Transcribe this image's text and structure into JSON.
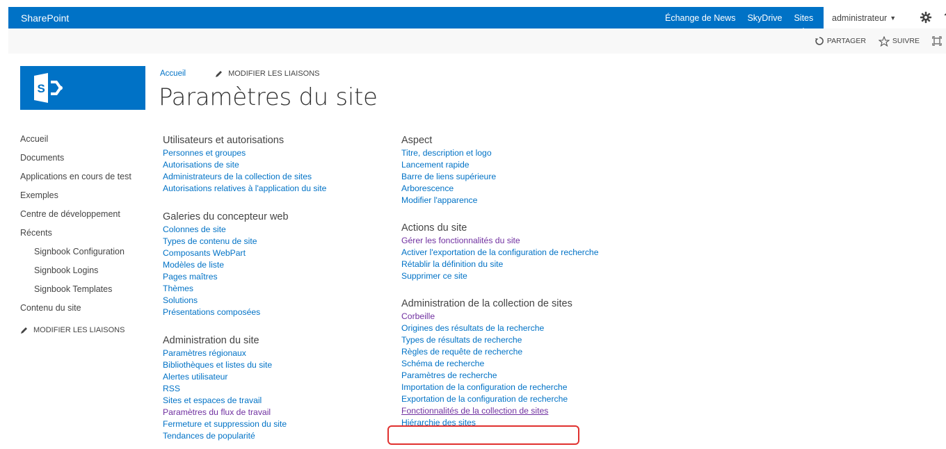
{
  "suite_bar": {
    "brand": "SharePoint",
    "links": [
      "Échange de News",
      "SkyDrive",
      "Sites"
    ],
    "user": "administrateur",
    "help": "?"
  },
  "ribbon": {
    "share": "PARTAGER",
    "follow": "SUIVRE"
  },
  "header": {
    "breadcrumb_home": "Accueil",
    "edit_links": "MODIFIER LES LIAISONS",
    "title": "Paramètres du site"
  },
  "left_nav": {
    "items": [
      "Accueil",
      "Documents",
      "Applications en cours de test",
      "Exemples",
      "Centre de développement",
      "Récents"
    ],
    "recent_items": [
      "Signbook Configuration",
      "Signbook Logins",
      "Signbook Templates"
    ],
    "site_contents": "Contenu du site",
    "edit_links": "MODIFIER LES LIAISONS"
  },
  "sections": {
    "users": {
      "title": "Utilisateurs et autorisations",
      "links": [
        "Personnes et groupes",
        "Autorisations de site",
        "Administrateurs de la collection de sites",
        "Autorisations relatives à l'application du site"
      ]
    },
    "galleries": {
      "title": "Galeries du concepteur web",
      "links": [
        "Colonnes de site",
        "Types de contenu de site",
        "Composants WebPart",
        "Modèles de liste",
        "Pages maîtres",
        "Thèmes",
        "Solutions",
        "Présentations composées"
      ]
    },
    "site_admin": {
      "title": "Administration du site",
      "links": [
        "Paramètres régionaux",
        "Bibliothèques et listes du site",
        "Alertes utilisateur",
        "RSS",
        "Sites et espaces de travail",
        "Paramètres du flux de travail",
        "Fermeture et suppression du site",
        "Tendances de popularité"
      ]
    },
    "look": {
      "title": "Aspect",
      "links": [
        "Titre, description et logo",
        "Lancement rapide",
        "Barre de liens supérieure",
        "Arborescence",
        "Modifier l'apparence"
      ]
    },
    "site_actions": {
      "title": "Actions du site",
      "links": [
        "Gérer les fonctionnalités du site",
        "Activer l'exportation de la configuration de recherche",
        "Rétablir la définition du site",
        "Supprimer ce site"
      ]
    },
    "collection_admin": {
      "title": "Administration de la collection de sites",
      "links": [
        "Corbeille",
        "Origines des résultats de la recherche",
        "Types de résultats de recherche",
        "Règles de requête de recherche",
        "Schéma de recherche",
        "Paramètres de recherche",
        "Importation de la configuration de recherche",
        "Exportation de la configuration de recherche",
        "Fonctionnalités de la collection de sites",
        "Hiérarchie des sites"
      ]
    }
  },
  "colors": {
    "suite_bar": "#0072c6",
    "link": "#0072c6",
    "visited_link": "#7030a0",
    "highlight": "#e0302e"
  }
}
